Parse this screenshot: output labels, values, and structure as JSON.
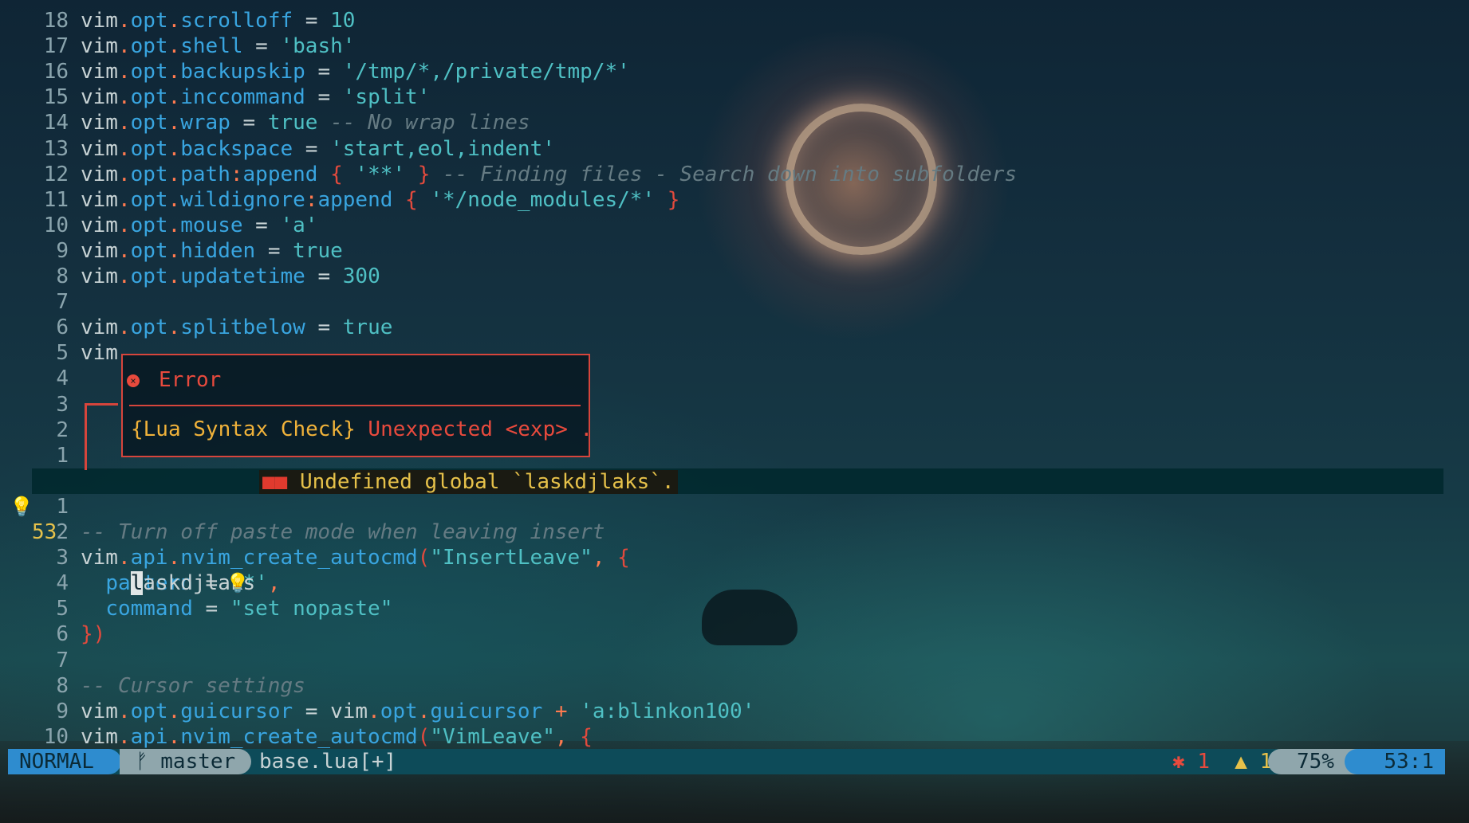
{
  "lines": [
    {
      "ln": "18",
      "tokens": [
        [
          "v",
          "vim"
        ],
        [
          "p",
          "."
        ],
        [
          "k",
          "opt"
        ],
        [
          "p",
          "."
        ],
        [
          "k",
          "scrolloff"
        ],
        [
          "v",
          " = "
        ],
        [
          "n",
          "10"
        ]
      ]
    },
    {
      "ln": "17",
      "tokens": [
        [
          "v",
          "vim"
        ],
        [
          "p",
          "."
        ],
        [
          "k",
          "opt"
        ],
        [
          "p",
          "."
        ],
        [
          "k",
          "shell"
        ],
        [
          "v",
          " = "
        ],
        [
          "s",
          "'bash'"
        ]
      ]
    },
    {
      "ln": "16",
      "tokens": [
        [
          "v",
          "vim"
        ],
        [
          "p",
          "."
        ],
        [
          "k",
          "opt"
        ],
        [
          "p",
          "."
        ],
        [
          "k",
          "backupskip"
        ],
        [
          "v",
          " = "
        ],
        [
          "s",
          "'/tmp/*,/private/tmp/*'"
        ]
      ]
    },
    {
      "ln": "15",
      "tokens": [
        [
          "v",
          "vim"
        ],
        [
          "p",
          "."
        ],
        [
          "k",
          "opt"
        ],
        [
          "p",
          "."
        ],
        [
          "k",
          "inccommand"
        ],
        [
          "v",
          " = "
        ],
        [
          "s",
          "'split'"
        ]
      ]
    },
    {
      "ln": "14",
      "tokens": [
        [
          "v",
          "vim"
        ],
        [
          "p",
          "."
        ],
        [
          "k",
          "opt"
        ],
        [
          "p",
          "."
        ],
        [
          "k",
          "wrap"
        ],
        [
          "v",
          " = "
        ],
        [
          "b",
          "true"
        ],
        [
          "c",
          " -- No wrap lines"
        ]
      ]
    },
    {
      "ln": "13",
      "tokens": [
        [
          "v",
          "vim"
        ],
        [
          "p",
          "."
        ],
        [
          "k",
          "opt"
        ],
        [
          "p",
          "."
        ],
        [
          "k",
          "backspace"
        ],
        [
          "v",
          " = "
        ],
        [
          "s",
          "'start,eol,indent'"
        ]
      ]
    },
    {
      "ln": "12",
      "tokens": [
        [
          "v",
          "vim"
        ],
        [
          "p",
          "."
        ],
        [
          "k",
          "opt"
        ],
        [
          "p",
          "."
        ],
        [
          "k",
          "path"
        ],
        [
          "p",
          ":"
        ],
        [
          "k",
          "append"
        ],
        [
          "v",
          " "
        ],
        [
          "br",
          "{"
        ],
        [
          "v",
          " "
        ],
        [
          "s",
          "'**'"
        ],
        [
          "v",
          " "
        ],
        [
          "br",
          "}"
        ],
        [
          "c",
          " -- Finding files - Search down into subfolders"
        ]
      ]
    },
    {
      "ln": "11",
      "tokens": [
        [
          "v",
          "vim"
        ],
        [
          "p",
          "."
        ],
        [
          "k",
          "opt"
        ],
        [
          "p",
          "."
        ],
        [
          "k",
          "wildignore"
        ],
        [
          "p",
          ":"
        ],
        [
          "k",
          "append"
        ],
        [
          "v",
          " "
        ],
        [
          "br",
          "{"
        ],
        [
          "v",
          " "
        ],
        [
          "s",
          "'*/node_modules/*'"
        ],
        [
          "v",
          " "
        ],
        [
          "br",
          "}"
        ]
      ]
    },
    {
      "ln": "10",
      "tokens": [
        [
          "v",
          "vim"
        ],
        [
          "p",
          "."
        ],
        [
          "k",
          "opt"
        ],
        [
          "p",
          "."
        ],
        [
          "k",
          "mouse"
        ],
        [
          "v",
          " = "
        ],
        [
          "s",
          "'a'"
        ]
      ]
    },
    {
      "ln": "9",
      "tokens": [
        [
          "v",
          "vim"
        ],
        [
          "p",
          "."
        ],
        [
          "k",
          "opt"
        ],
        [
          "p",
          "."
        ],
        [
          "k",
          "hidden"
        ],
        [
          "v",
          " = "
        ],
        [
          "b",
          "true"
        ]
      ]
    },
    {
      "ln": "8",
      "tokens": [
        [
          "v",
          "vim"
        ],
        [
          "p",
          "."
        ],
        [
          "k",
          "opt"
        ],
        [
          "p",
          "."
        ],
        [
          "k",
          "updatetime"
        ],
        [
          "v",
          " = "
        ],
        [
          "n",
          "300"
        ]
      ]
    },
    {
      "ln": "7",
      "tokens": []
    },
    {
      "ln": "6",
      "tokens": [
        [
          "v",
          "vim"
        ],
        [
          "p",
          "."
        ],
        [
          "k",
          "opt"
        ],
        [
          "p",
          "."
        ],
        [
          "k",
          "splitbelow"
        ],
        [
          "v",
          " = "
        ],
        [
          "b",
          "true"
        ]
      ]
    },
    {
      "ln": "5",
      "tokens": [
        [
          "v",
          "vim"
        ]
      ]
    },
    {
      "ln": "4",
      "tokens": []
    },
    {
      "ln": "3",
      "tokens": []
    },
    {
      "ln": "2",
      "tokens": []
    },
    {
      "ln": "1",
      "tokens": []
    },
    {
      "ln": "__CURSOR__",
      "tokens": []
    },
    {
      "ln": "1",
      "tokens": []
    },
    {
      "ln": "2",
      "tokens": [
        [
          "c",
          "-- Turn off paste mode when leaving insert"
        ]
      ]
    },
    {
      "ln": "3",
      "tokens": [
        [
          "v",
          "vim"
        ],
        [
          "p",
          "."
        ],
        [
          "k",
          "api"
        ],
        [
          "p",
          "."
        ],
        [
          "k",
          "nvim_create_autocmd"
        ],
        [
          "br",
          "("
        ],
        [
          "s",
          "\"InsertLeave\""
        ],
        [
          "p",
          ", "
        ],
        [
          "br",
          "{"
        ]
      ]
    },
    {
      "ln": "4",
      "tokens": [
        [
          "v",
          "  "
        ],
        [
          "k",
          "pattern"
        ],
        [
          "v",
          " = "
        ],
        [
          "s",
          "'*'"
        ],
        [
          "p",
          ","
        ]
      ]
    },
    {
      "ln": "5",
      "tokens": [
        [
          "v",
          "  "
        ],
        [
          "k",
          "command"
        ],
        [
          "v",
          " = "
        ],
        [
          "s",
          "\"set nopaste\""
        ]
      ]
    },
    {
      "ln": "6",
      "tokens": [
        [
          "br",
          "})"
        ]
      ]
    },
    {
      "ln": "7",
      "tokens": []
    },
    {
      "ln": "8",
      "tokens": [
        [
          "c",
          "-- Cursor settings"
        ]
      ]
    },
    {
      "ln": "9",
      "tokens": [
        [
          "v",
          "vim"
        ],
        [
          "p",
          "."
        ],
        [
          "k",
          "opt"
        ],
        [
          "p",
          "."
        ],
        [
          "k",
          "guicursor"
        ],
        [
          "v",
          " = "
        ],
        [
          "v",
          "vim"
        ],
        [
          "p",
          "."
        ],
        [
          "k",
          "opt"
        ],
        [
          "p",
          "."
        ],
        [
          "k",
          "guicursor"
        ],
        [
          "v",
          " "
        ],
        [
          "p",
          "+"
        ],
        [
          "v",
          " "
        ],
        [
          "s",
          "'a:blinkon100'"
        ]
      ]
    },
    {
      "ln": "10",
      "tokens": [
        [
          "v",
          "vim"
        ],
        [
          "p",
          "."
        ],
        [
          "k",
          "api"
        ],
        [
          "p",
          "."
        ],
        [
          "k",
          "nvim_create_autocmd"
        ],
        [
          "br",
          "("
        ],
        [
          "s",
          "\"VimLeave\""
        ],
        [
          "p",
          ", "
        ],
        [
          "br",
          "{"
        ]
      ]
    }
  ],
  "cursor_line": {
    "number": "53",
    "cursor_char": "l",
    "rest": "askdjlaks",
    "diagnostic": "Undefined global `laskdjlaks`."
  },
  "error_popup": {
    "title": "Error",
    "source": "{Lua Syntax Check}",
    "message": "Unexpected <exp> ."
  },
  "statusline": {
    "mode": "NORMAL",
    "branch": "master",
    "filename": "base.lua[+]",
    "errors": "1",
    "warnings": "1",
    "percent": "75%",
    "position": "53:1"
  },
  "colors": {
    "keyword": "#39a5e0",
    "string": "#4fc0c4",
    "punct": "#ff7a4f",
    "bracket": "#e24a3d",
    "comment": "#657b83",
    "error": "#e84a3d",
    "warning": "#e6c14a",
    "mode_bg": "#2e8ccf",
    "statusline_bg": "#0d4b59"
  },
  "icons": {
    "lightbulb": "lightbulb-icon",
    "error_circle": "error-circle-icon",
    "git_branch": "git-branch-icon",
    "bug": "bug-icon",
    "warning": "warning-icon"
  }
}
